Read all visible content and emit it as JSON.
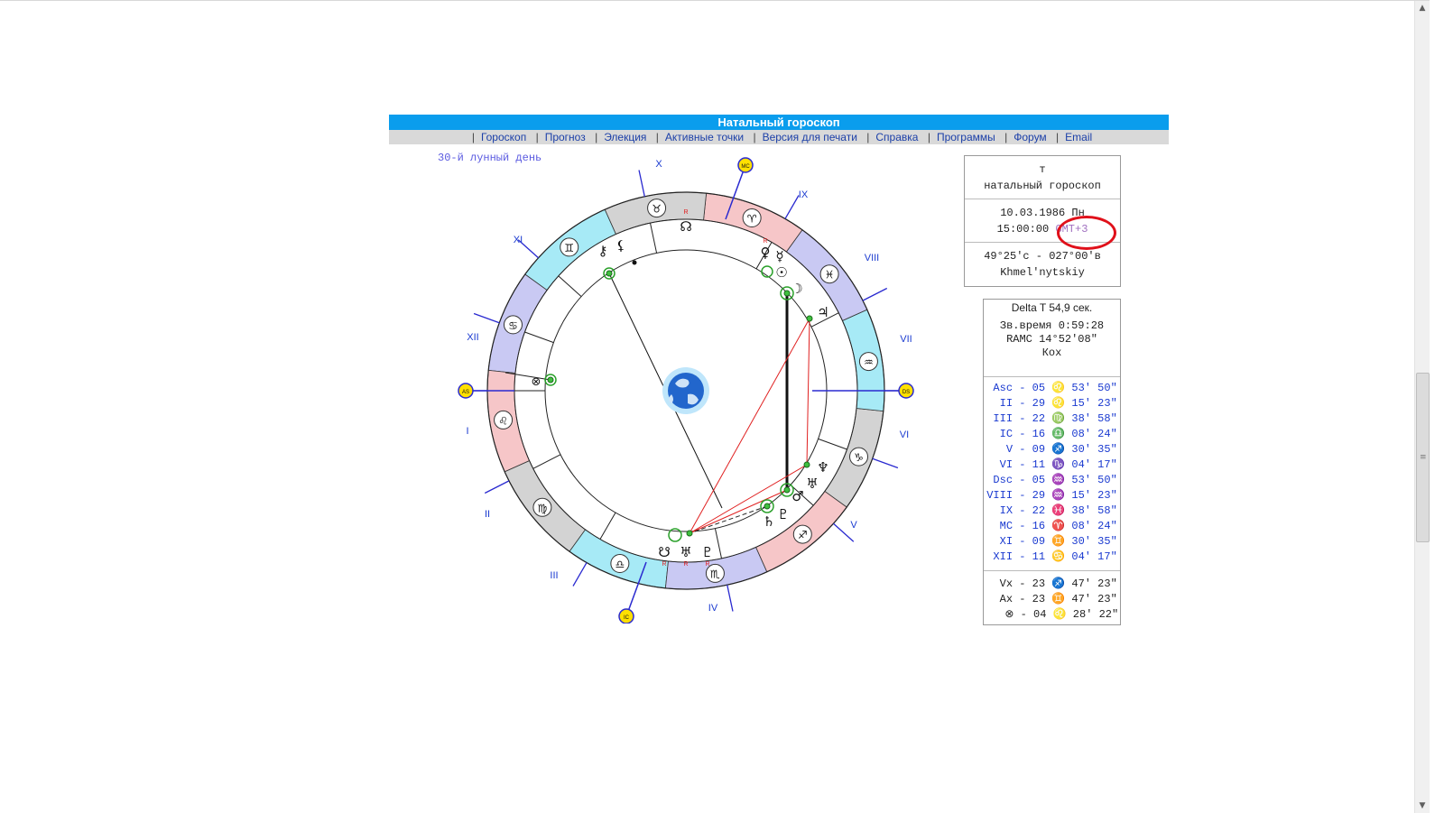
{
  "header": {
    "title": "Натальный гороскоп"
  },
  "menu": [
    "Гороскоп",
    "Прогноз",
    "Элекция",
    "Активные точки",
    "Версия для печати",
    "Справка",
    "Программы",
    "Форум",
    "Email"
  ],
  "lunar_day": "30-й лунный день",
  "house_labels": [
    "I",
    "II",
    "III",
    "IV",
    "V",
    "VI",
    "VII",
    "VIII",
    "IX",
    "X",
    "XI",
    "XII"
  ],
  "angle_markers": {
    "asc": "AS",
    "dsc": "DS",
    "mc": "MC",
    "ic": "IC"
  },
  "info_box": {
    "name": "т",
    "type": "натальный гороскоп",
    "date": "10.03.1986 Пн",
    "time": "15:00:00",
    "timezone": "GMT+3",
    "coords": "49°25'с - 027°00'в",
    "city": "Khmel'nytskiy"
  },
  "calc_box": {
    "delta_t": "Delta T  54,9 сек.",
    "sidereal_time": "Зв.время 0:59:28",
    "ramc": "RAMC 14°52'08\"",
    "house_system": "Кох"
  },
  "houses": [
    {
      "name": "Asc",
      "deg": "05",
      "sign": "♌",
      "min": "53' 50\""
    },
    {
      "name": "II",
      "deg": "29",
      "sign": "♌",
      "min": "15' 23\""
    },
    {
      "name": "III",
      "deg": "22",
      "sign": "♍",
      "min": "38' 58\""
    },
    {
      "name": "IC",
      "deg": "16",
      "sign": "♎",
      "min": "08' 24\""
    },
    {
      "name": "V",
      "deg": "09",
      "sign": "♐",
      "min": "30' 35\""
    },
    {
      "name": "VI",
      "deg": "11",
      "sign": "♑",
      "min": "04' 17\""
    },
    {
      "name": "Dsc",
      "deg": "05",
      "sign": "♒",
      "min": "53' 50\""
    },
    {
      "name": "VIII",
      "deg": "29",
      "sign": "♒",
      "min": "15' 23\""
    },
    {
      "name": "IX",
      "deg": "22",
      "sign": "♓",
      "min": "38' 58\""
    },
    {
      "name": "MC",
      "deg": "16",
      "sign": "♈",
      "min": "08' 24\""
    },
    {
      "name": "XI",
      "deg": "09",
      "sign": "♊",
      "min": "30' 35\""
    },
    {
      "name": "XII",
      "deg": "11",
      "sign": "♋",
      "min": "04' 17\""
    }
  ],
  "extra_points": [
    {
      "name": "Vx",
      "deg": "23",
      "sign": "♐",
      "min": "47' 23\""
    },
    {
      "name": "Ax",
      "deg": "23",
      "sign": "♊",
      "min": "47' 23\""
    },
    {
      "name": "⊗",
      "deg": "04",
      "sign": "♌",
      "min": "28' 22\""
    }
  ],
  "colors": {
    "title_bar": "#0a9ded",
    "menu_bg": "#d9d9d9",
    "link": "#1b3fa8",
    "house_text": "#1a3ad0",
    "highlight": "#e0101a"
  }
}
